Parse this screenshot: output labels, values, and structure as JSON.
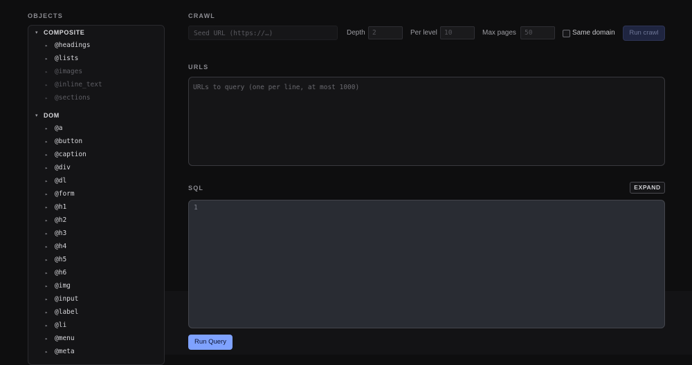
{
  "objects": {
    "label": "OBJECTS",
    "groups": [
      {
        "name": "COMPOSITE",
        "items": [
          {
            "label": "@headings",
            "dim": false
          },
          {
            "label": "@lists",
            "dim": false
          },
          {
            "label": "@images",
            "dim": true
          },
          {
            "label": "@inline_text",
            "dim": true
          },
          {
            "label": "@sections",
            "dim": true
          }
        ]
      },
      {
        "name": "DOM",
        "items": [
          {
            "label": "@a",
            "dim": false
          },
          {
            "label": "@button",
            "dim": false
          },
          {
            "label": "@caption",
            "dim": false
          },
          {
            "label": "@div",
            "dim": false
          },
          {
            "label": "@dl",
            "dim": false
          },
          {
            "label": "@form",
            "dim": false
          },
          {
            "label": "@h1",
            "dim": false
          },
          {
            "label": "@h2",
            "dim": false
          },
          {
            "label": "@h3",
            "dim": false
          },
          {
            "label": "@h4",
            "dim": false
          },
          {
            "label": "@h5",
            "dim": false
          },
          {
            "label": "@h6",
            "dim": false
          },
          {
            "label": "@img",
            "dim": false
          },
          {
            "label": "@input",
            "dim": false
          },
          {
            "label": "@label",
            "dim": false
          },
          {
            "label": "@li",
            "dim": false
          },
          {
            "label": "@menu",
            "dim": false
          },
          {
            "label": "@meta",
            "dim": false
          }
        ]
      }
    ]
  },
  "crawl": {
    "label": "CRAWL",
    "seed_placeholder": "Seed URL (https://…)",
    "depth_label": "Depth",
    "depth_value": "2",
    "per_level_label": "Per level",
    "per_level_value": "10",
    "max_pages_label": "Max pages",
    "max_pages_value": "50",
    "same_domain_label": "Same domain",
    "same_domain_checked": false,
    "run_label": "Run crawl"
  },
  "urls": {
    "label": "URLS",
    "placeholder": "URLs to query (one per line, at most 1000)"
  },
  "sql": {
    "label": "SQL",
    "expand_label": "EXPAND",
    "line_number": "1",
    "run_label": "Run Query"
  }
}
